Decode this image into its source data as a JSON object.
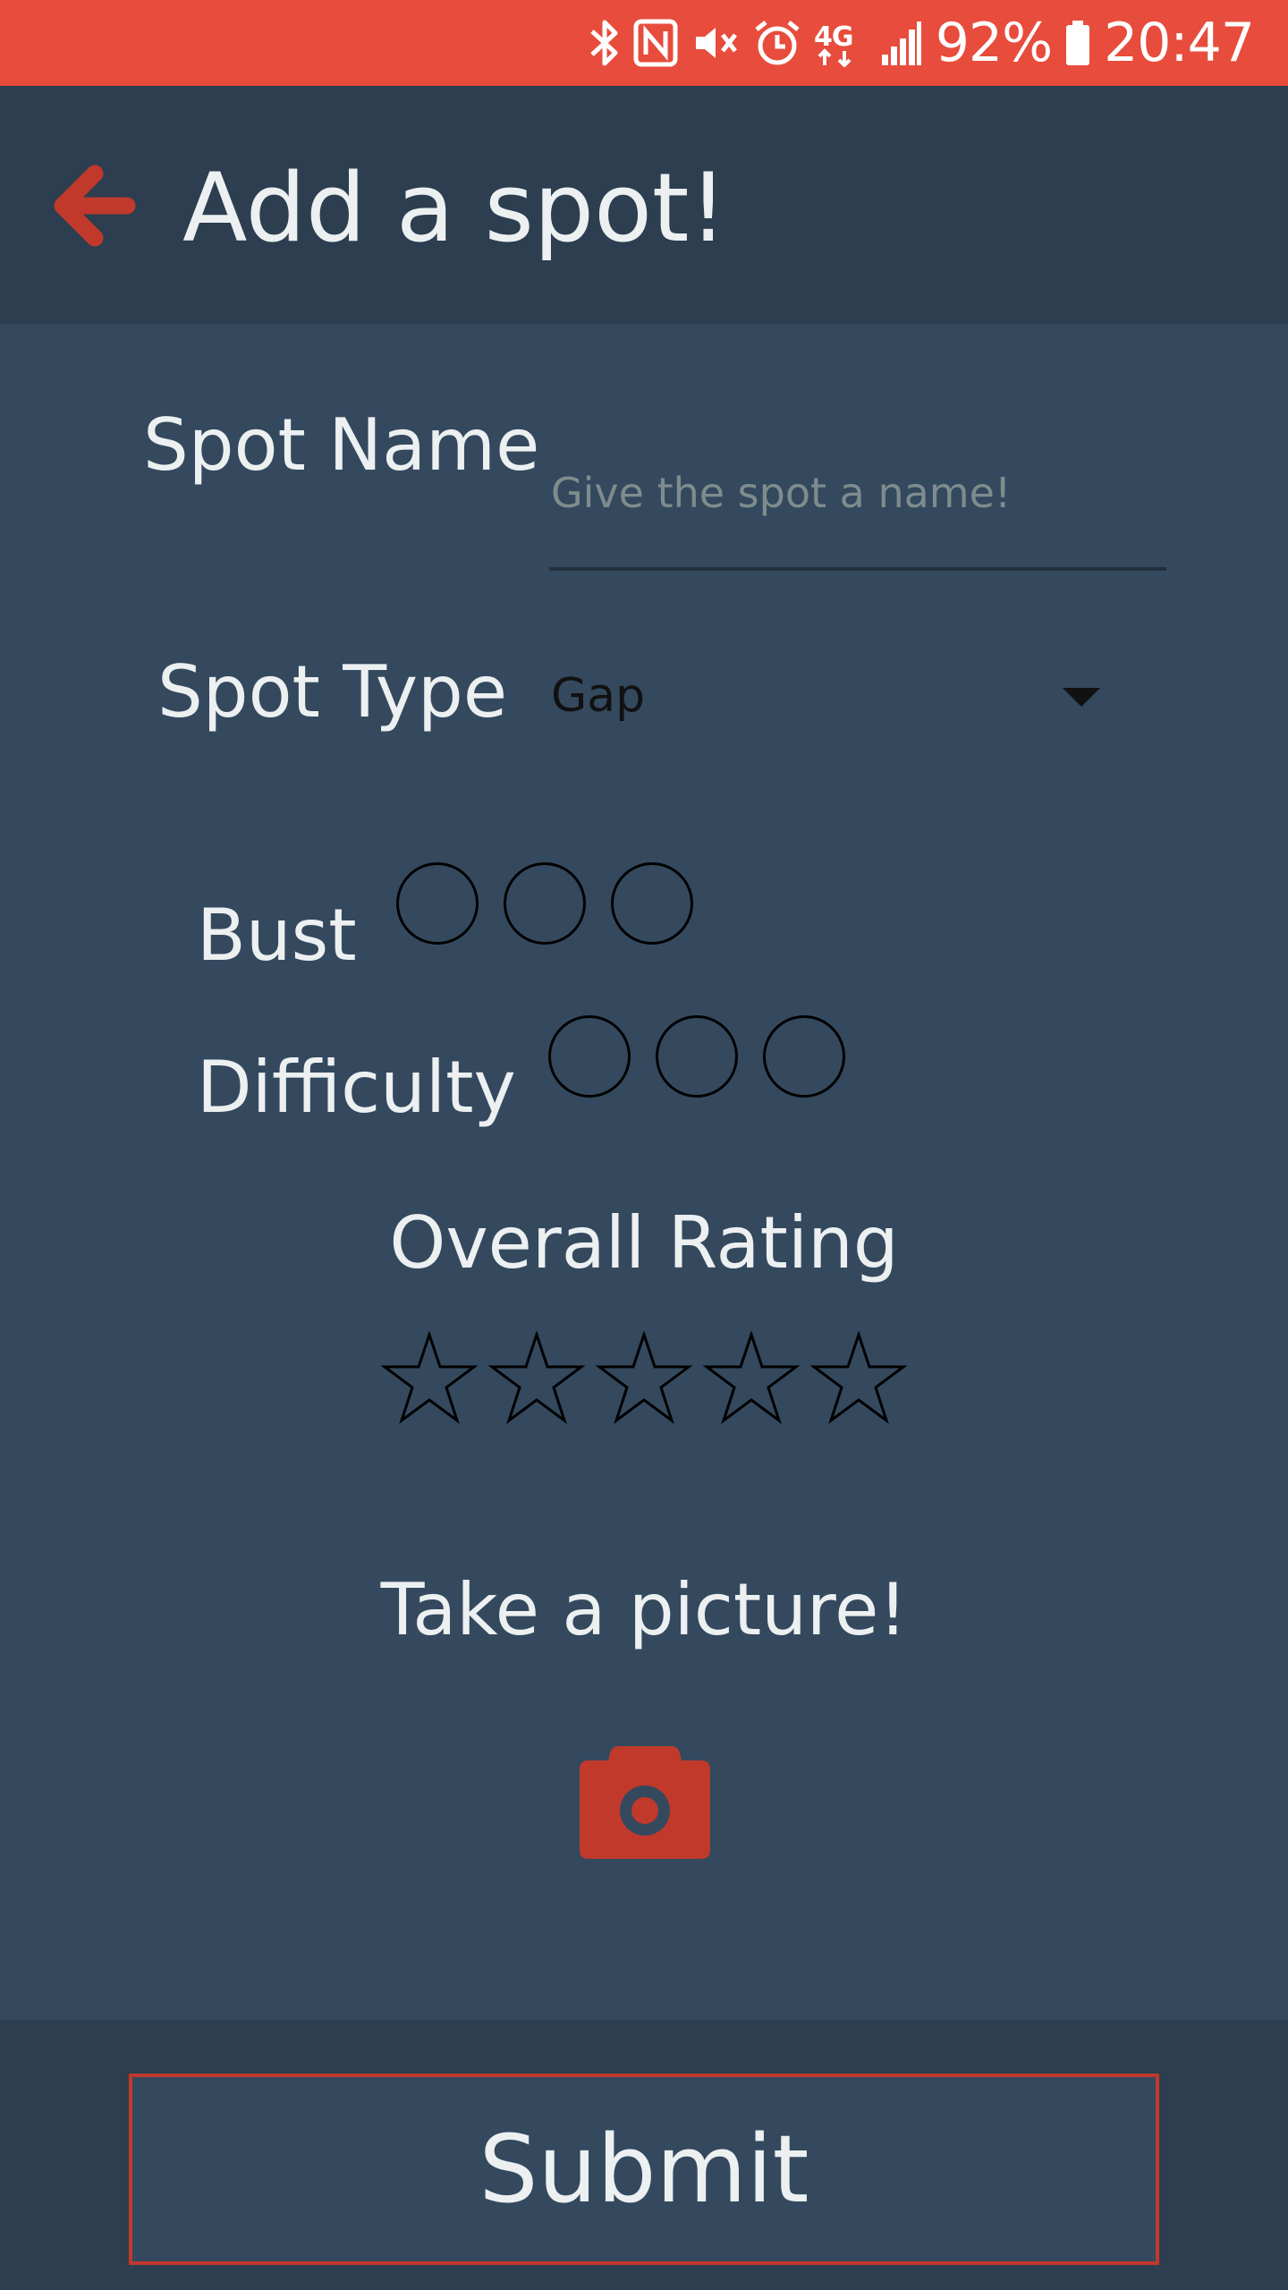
{
  "status_bar": {
    "battery": "92%",
    "time": "20:47",
    "network": "4G",
    "icons": [
      "bluetooth-icon",
      "nfc-icon",
      "vibrate-icon",
      "alarm-icon",
      "4g-icon",
      "signal-icon",
      "battery-icon"
    ],
    "background_color": "#e74c3c"
  },
  "app_bar": {
    "title": "Add a spot!",
    "back_icon": "arrow-left-icon",
    "accent_color": "#c0392b",
    "background_color": "#2c3e50"
  },
  "form": {
    "spot_name": {
      "label": "Spot Name",
      "value": "",
      "placeholder": "Give the spot a name!"
    },
    "spot_type": {
      "label": "Spot Type",
      "selected": "Gap"
    },
    "bust": {
      "label": "Bust",
      "selected": 0,
      "max": 3
    },
    "difficulty": {
      "label": "Difficulty",
      "selected": 0,
      "max": 3
    },
    "overall_rating": {
      "label": "Overall Rating",
      "selected": 0,
      "max": 5
    },
    "picture": {
      "label": "Take a picture!",
      "icon": "camera-icon"
    }
  },
  "submit": {
    "label": "Submit"
  },
  "colors": {
    "background": "#34495e",
    "bars": "#2c3e50",
    "accent": "#c0392b",
    "text": "#ecf0f1"
  }
}
